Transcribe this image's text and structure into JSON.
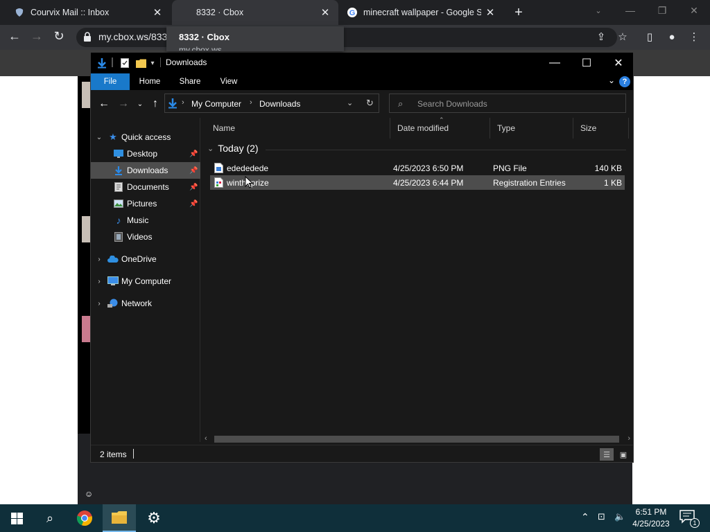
{
  "browser": {
    "tabs": [
      {
        "title": "Courvix Mail :: Inbox",
        "icon": "courvix-favicon-icon"
      },
      {
        "title": "8332 · Cbox",
        "icon": ""
      },
      {
        "title": "minecraft wallpaper - Google Search",
        "icon": "google-favicon-icon"
      }
    ],
    "close_glyph": "✕",
    "url": "my.cbox.ws/833",
    "tooltip": {
      "title": "8332 · Cbox",
      "subtitle": "my.cbox.ws"
    }
  },
  "explorer": {
    "title": "Downloads",
    "ribbon_tabs": [
      "File",
      "Home",
      "Share",
      "View"
    ],
    "breadcrumb": [
      "My Computer",
      "Downloads"
    ],
    "search_placeholder": "Search Downloads",
    "nav": {
      "quick_access": "Quick access",
      "items": [
        "Desktop",
        "Downloads",
        "Documents",
        "Pictures",
        "Music",
        "Videos"
      ],
      "roots": [
        "OneDrive",
        "My Computer",
        "Network"
      ]
    },
    "columns": [
      "Name",
      "Date modified",
      "Type",
      "Size"
    ],
    "group": "Today (2)",
    "files": [
      {
        "name": "edededede",
        "date": "4/25/2023 6:50 PM",
        "type": "PNG File",
        "size": "140 KB"
      },
      {
        "name": "wintheprize",
        "date": "4/25/2023 6:44 PM",
        "type": "Registration Entries",
        "size": "1 KB"
      }
    ],
    "status": "2 items"
  },
  "taskbar": {
    "time": "6:51 PM",
    "date": "4/25/2023",
    "notification_count": "1"
  },
  "colors": {
    "explorer_bg": "#191919",
    "file_tab": "#1979ca",
    "taskbar": "#0f2f3a",
    "chrome_tabbar": "#202124"
  }
}
